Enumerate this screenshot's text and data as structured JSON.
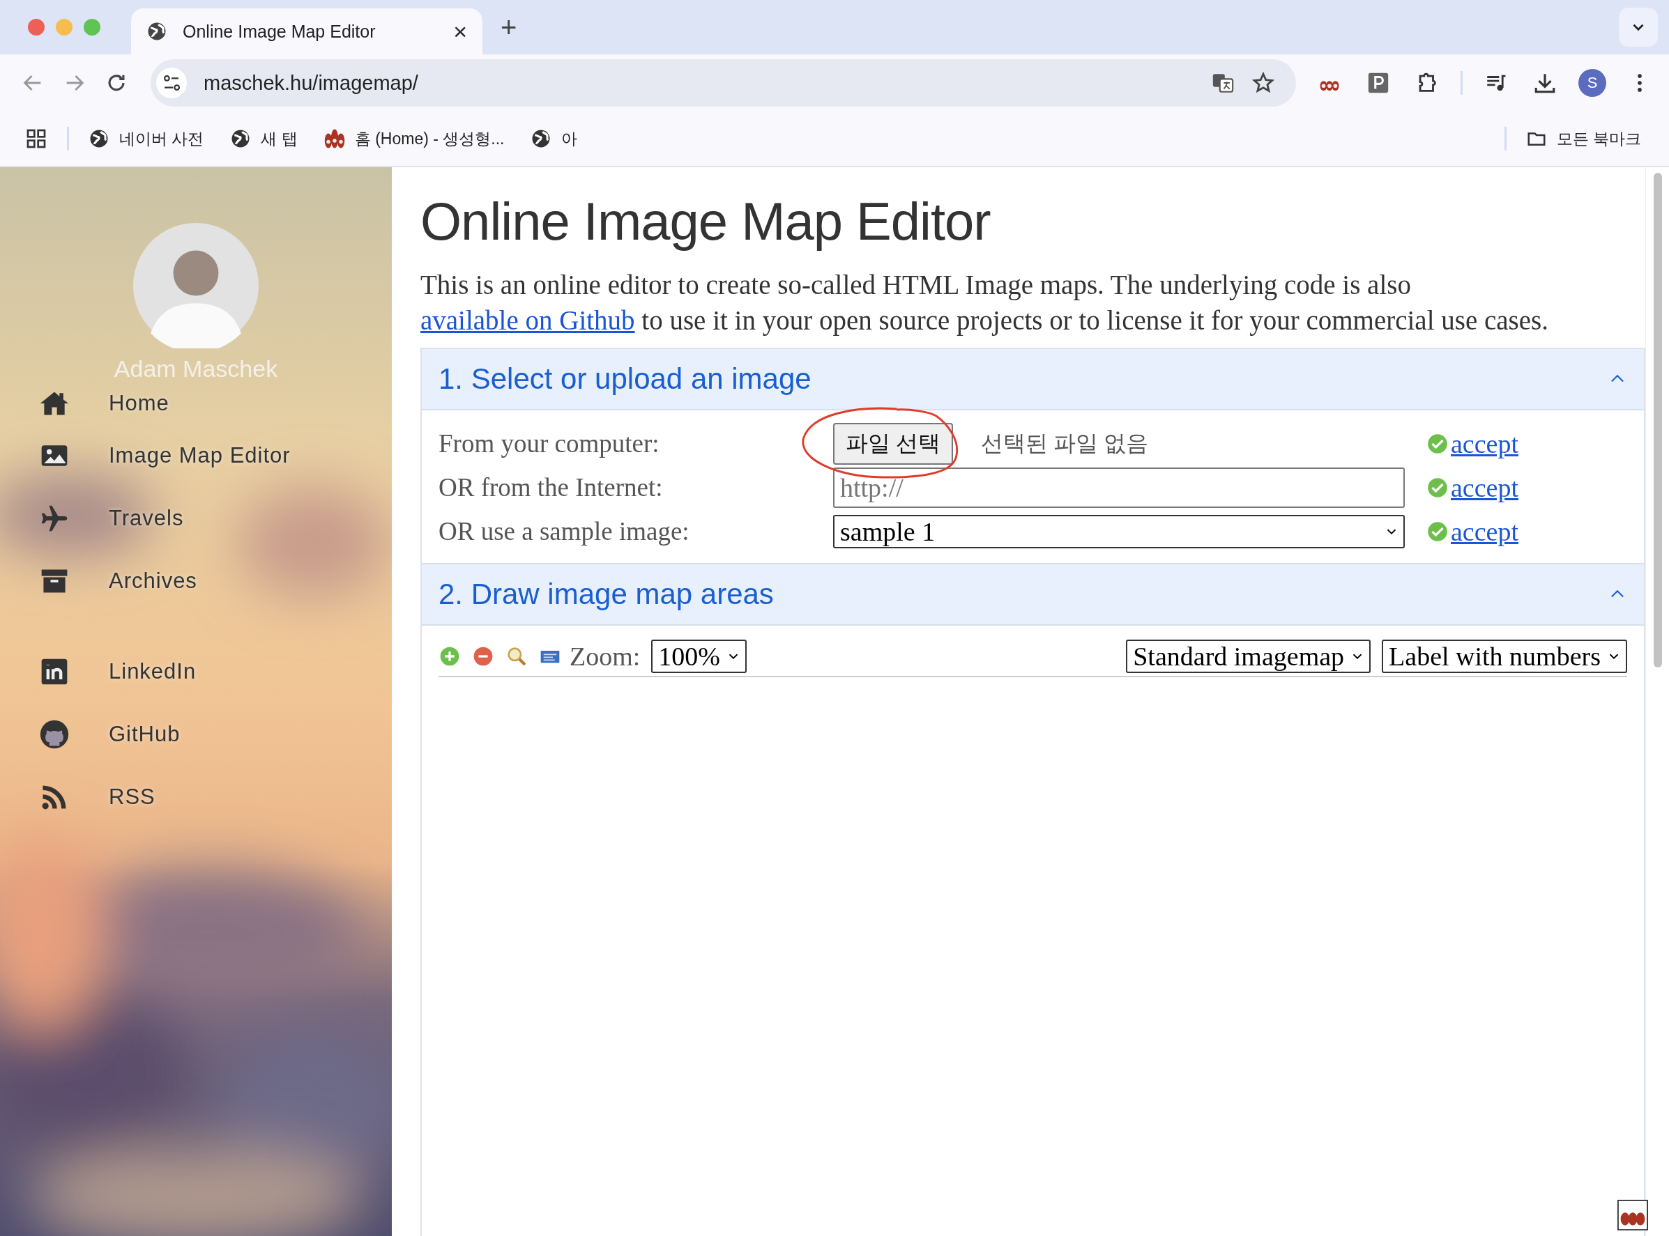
{
  "browser": {
    "tab": {
      "title": "Online Image Map Editor",
      "close": "×",
      "selected": true
    },
    "new_tab": "+",
    "address": "maschek.hu/imagemap/",
    "profile": "S",
    "bookmarks": [
      {
        "label": "네이버 사전",
        "kind": "globe"
      },
      {
        "label": "새 탭",
        "kind": "globe"
      },
      {
        "label": "홈 (Home) - 생성형...",
        "kind": "favicon"
      },
      {
        "label": "아",
        "kind": "globe"
      }
    ],
    "all_bookmarks": "모든 북마크"
  },
  "sidebar": {
    "name": "Adam Maschek",
    "nav": [
      {
        "label": "Home",
        "kind": "home"
      },
      {
        "label": "Image Map Editor"
      },
      {
        "label": "Travels",
        "kind": "plane"
      },
      {
        "label": "Archives",
        "kind": "archive"
      }
    ],
    "social": [
      {
        "label": "LinkedIn",
        "kind": "linkedin"
      },
      {
        "label": "GitHub",
        "kind": "github"
      },
      {
        "label": "RSS",
        "kind": "rss"
      }
    ]
  },
  "page": {
    "title": "Online Image Map Editor",
    "intro_before": "This is an online editor to create so-called HTML Image maps. The underlying code is also ",
    "intro_link": "available on Github",
    "intro_after": " to use it in your open source projects or to license it for your commercial use cases.",
    "sections": [
      {
        "title": "1. Select or upload an image",
        "expanded": true,
        "rows": [
          {
            "kind": "file",
            "label": "From your computer:",
            "button": "파일 선택",
            "status": "선택된 파일 없음",
            "action": "accept",
            "circled": true
          },
          {
            "kind": "url",
            "label": "OR from the Internet:",
            "placeholder": "http://",
            "action": "accept"
          },
          {
            "kind": "select",
            "label": "OR use a sample image:",
            "value": "sample 1",
            "action": "accept"
          }
        ]
      },
      {
        "title": "2. Draw image map areas",
        "expanded": true,
        "toolbar": {
          "zoom_label": "Zoom:",
          "zoom_value": "100%",
          "selects": [
            "Standard imagemap",
            "Label with numbers"
          ]
        }
      }
    ]
  }
}
